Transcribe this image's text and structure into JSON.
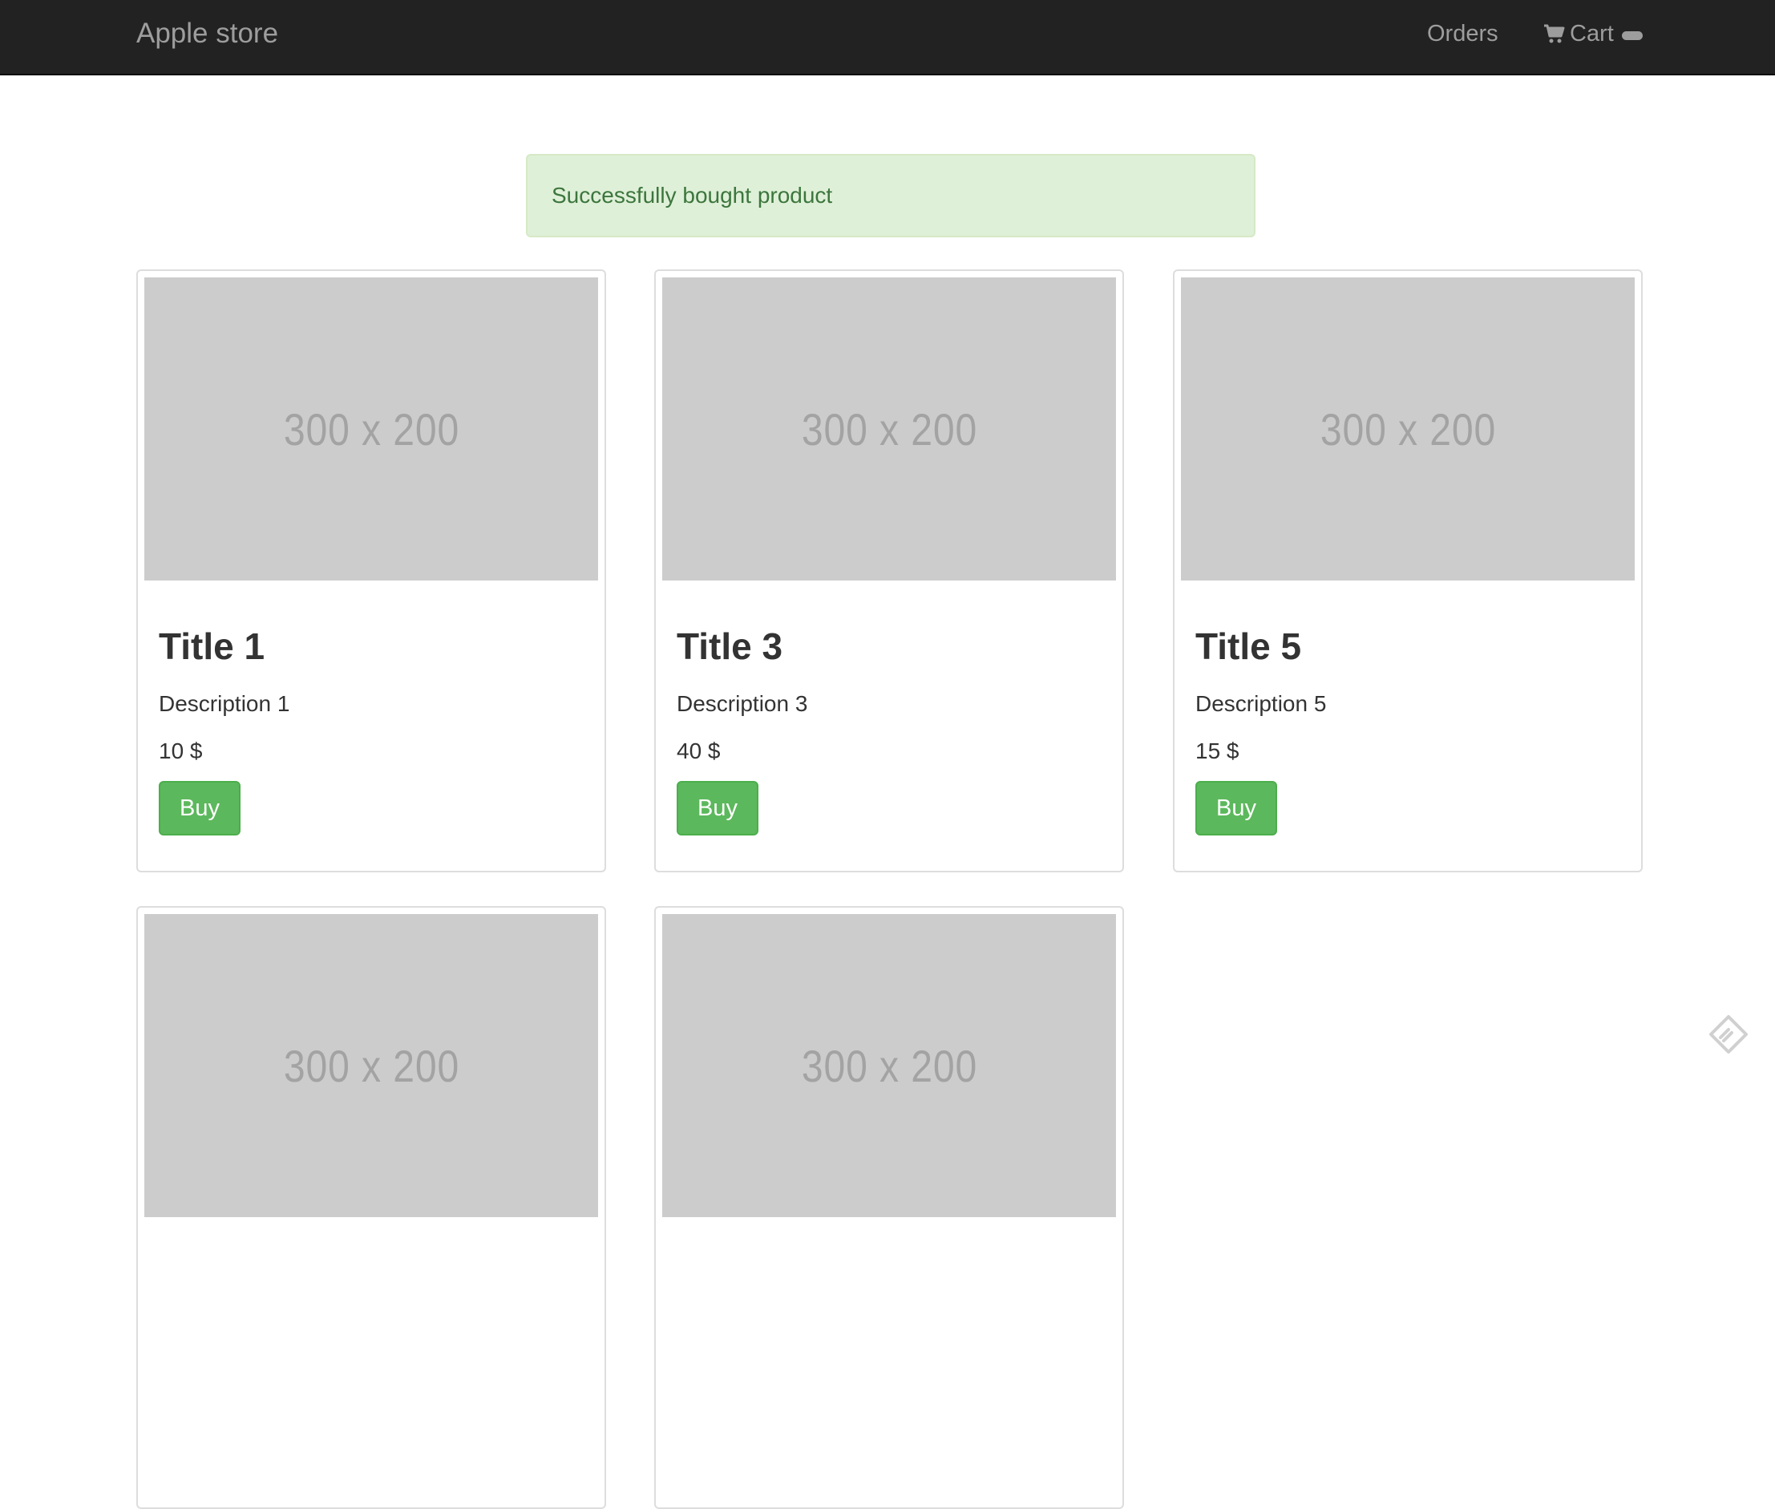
{
  "navbar": {
    "brand": "Apple store",
    "orders_label": "Orders",
    "cart_label": "Cart",
    "cart_icon": "shopping-cart-icon"
  },
  "alert": {
    "message": "Successfully bought product"
  },
  "products": [
    {
      "placeholder": "300 x 200",
      "title": "Title 1",
      "description": "Description 1",
      "price": "10 $",
      "buy_label": "Buy"
    },
    {
      "placeholder": "300 x 200",
      "title": "Title 3",
      "description": "Description 3",
      "price": "40 $",
      "buy_label": "Buy"
    },
    {
      "placeholder": "300 x 200",
      "title": "Title 5",
      "description": "Description 5",
      "price": "15 $",
      "buy_label": "Buy"
    },
    {
      "placeholder": "300 x 200"
    },
    {
      "placeholder": "300 x 200"
    }
  ],
  "colors": {
    "navbar_bg": "#222222",
    "nav_text": "#9d9d9d",
    "alert_bg": "#dff0d8",
    "alert_text": "#3c763d",
    "buy_button": "#5cb85c",
    "placeholder_bg": "#cccccc"
  }
}
